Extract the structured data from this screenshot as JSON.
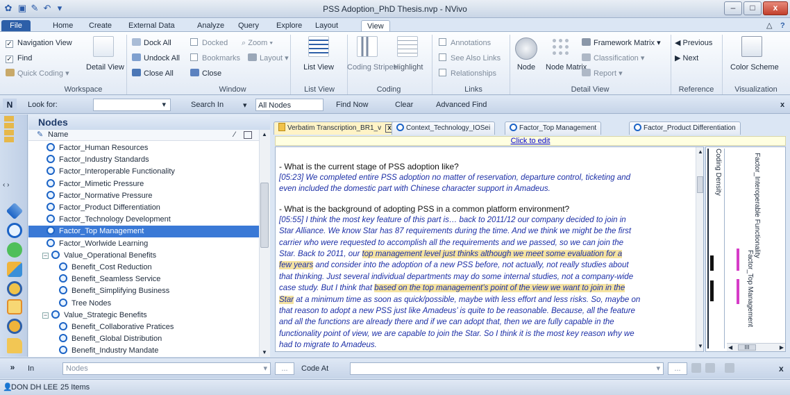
{
  "window": {
    "title": "PSS Adoption_PhD Thesis.nvp - NVivo",
    "minimize": "–",
    "maximize": "□",
    "close": "x"
  },
  "tabs": [
    "File",
    "Home",
    "Create",
    "External Data",
    "Analyze",
    "Query",
    "Explore",
    "Layout",
    "View"
  ],
  "active_tab": "View",
  "ribbon": {
    "workspace": {
      "label": "Workspace",
      "navigation_view": "Navigation View",
      "find": "Find",
      "quick_coding": "Quick Coding",
      "detail_view": "Detail View"
    },
    "window": {
      "label": "Window",
      "dock_all": "Dock All",
      "undock_all": "Undock All",
      "close_all": "Close All",
      "docked": "Docked",
      "bookmarks": "Bookmarks",
      "close": "Close",
      "zoom": "Zoom",
      "layout": "Layout"
    },
    "list_view": {
      "label": "List View",
      "list_view_btn": "List View"
    },
    "coding": {
      "label": "Coding",
      "coding_stripes": "Coding Stripes",
      "highlight": "Highlight"
    },
    "links": {
      "label": "Links",
      "annotations": "Annotations",
      "see_also_links": "See Also Links",
      "relationships": "Relationships"
    },
    "detail_view": {
      "label": "Detail View",
      "node": "Node",
      "node_matrix": "Node Matrix",
      "framework_matrix": "Framework Matrix",
      "classification": "Classification",
      "report": "Report"
    },
    "reference": {
      "label": "Reference",
      "previous": "Previous",
      "next": "Next"
    },
    "visualization": {
      "label": "Visualization",
      "color_scheme": "Color Scheme"
    }
  },
  "findbar": {
    "n": "N",
    "look_for": "Look for:",
    "search_in": "Search In",
    "scope": "All Nodes",
    "find_now": "Find Now",
    "clear": "Clear",
    "advanced_find": "Advanced Find",
    "close": "x"
  },
  "nodes": {
    "header": "Nodes",
    "col_name": "Name",
    "rows": [
      {
        "label": "Factor_Human Resources",
        "indent": 1
      },
      {
        "label": "Factor_Industry Standards",
        "indent": 1
      },
      {
        "label": "Factor_Interoperable Functionality",
        "indent": 1
      },
      {
        "label": "Factor_Mimetic Pressure",
        "indent": 1
      },
      {
        "label": "Factor_Normative Pressure",
        "indent": 1
      },
      {
        "label": "Factor_Product Differentiation",
        "indent": 1
      },
      {
        "label": "Factor_Technology Development",
        "indent": 1
      },
      {
        "label": "Factor_Top Management",
        "indent": 1,
        "selected": true
      },
      {
        "label": "Factor_Worlwide Learning",
        "indent": 1
      },
      {
        "label": "Value_Operational Benefits",
        "indent": 0,
        "expander": "−"
      },
      {
        "label": "Benefit_Cost Reduction",
        "indent": 2
      },
      {
        "label": "Benefit_Seamless Service",
        "indent": 2
      },
      {
        "label": "Benefit_Simplifying Business",
        "indent": 2
      },
      {
        "label": "Tree Nodes",
        "indent": 2
      },
      {
        "label": "Value_Strategic Benefits",
        "indent": 0,
        "expander": "−"
      },
      {
        "label": "Benefit_Collaborative Pratices",
        "indent": 2
      },
      {
        "label": "Benefit_Global Distribution",
        "indent": 2
      },
      {
        "label": "Benefit_Industry Mandate",
        "indent": 2
      }
    ]
  },
  "doc_tabs": [
    {
      "label": "Verbatim Transcription_BR1_v",
      "active": true
    },
    {
      "label": "Context_Technology_IOSei"
    },
    {
      "label": "Factor_Top Management"
    },
    {
      "label": "Factor_Product Differentiation"
    }
  ],
  "doc": {
    "click_to_edit": "Click to edit",
    "q1": "- What is the current stage of PSS adoption like?",
    "a1_l1": "[05:23] We completed entire PSS adoption no matter of reservation, departure control, ticketing and",
    "a1_l2": "even included the domestic part with Chinese character support in Amadeus.",
    "q2": "- What is the background of adopting PSS in a common platform environment?",
    "a2_l1": "[05:55] I think the most key feature of this part is… back to 2011/12 our company decided to join in",
    "a2_l2": "Star Alliance. We know Star has 87 requirements during the time. And we think we might be the first",
    "a2_l3": "carrier who were requested to accomplish all the requirements and we passed, so we can join the",
    "a2_l4a": "Star. Back to 2011, our ",
    "a2_l4b": "top management level just thinks although we meet some evaluation for a",
    "a2_l5a": "few years",
    "a2_l5b": " and consider into the adoption of a new PSS before, not actually, not really studies about",
    "a2_l6": "that thinking. Just several individual departments may do some internal studies, not a company-wide",
    "a2_l7a": "case study. But I think that ",
    "a2_l7b": "based on the top management’s point of the view we want to join in the",
    "a2_l8a": "Star",
    "a2_l8b": " at a minimum time as soon as quick/possible, maybe with less effort and less risks. So, maybe on",
    "a2_l9": "that reason to adopt a new PSS just like Amadeus’ is quite to be reasonable. Because, all the feature",
    "a2_l10": "and all the functions are already there and if we can adopt that, then we are fully capable in the",
    "a2_l11": "functionality point of view, we are capable to join the Star. So I think it is the most key reason why we",
    "a2_l12": "had to migrate to Amadeus."
  },
  "stripes": {
    "coding_density": "Coding Density",
    "stripe1": "Factor_Interoperable Functionality",
    "stripe2": "Factor_Top Management",
    "scroll_label": "III"
  },
  "codebar": {
    "in": "In",
    "nodes_placeholder": "Nodes",
    "dots": "...",
    "code_at": "Code At",
    "close": "x"
  },
  "status": {
    "user": "DON DH LEE",
    "items": "25 Items"
  },
  "colors": {
    "accent": "#2d5fa8",
    "selected_row": "#3a79d6",
    "highlight": "#f5e3a1",
    "stripe_magenta": "#d63cc8"
  }
}
